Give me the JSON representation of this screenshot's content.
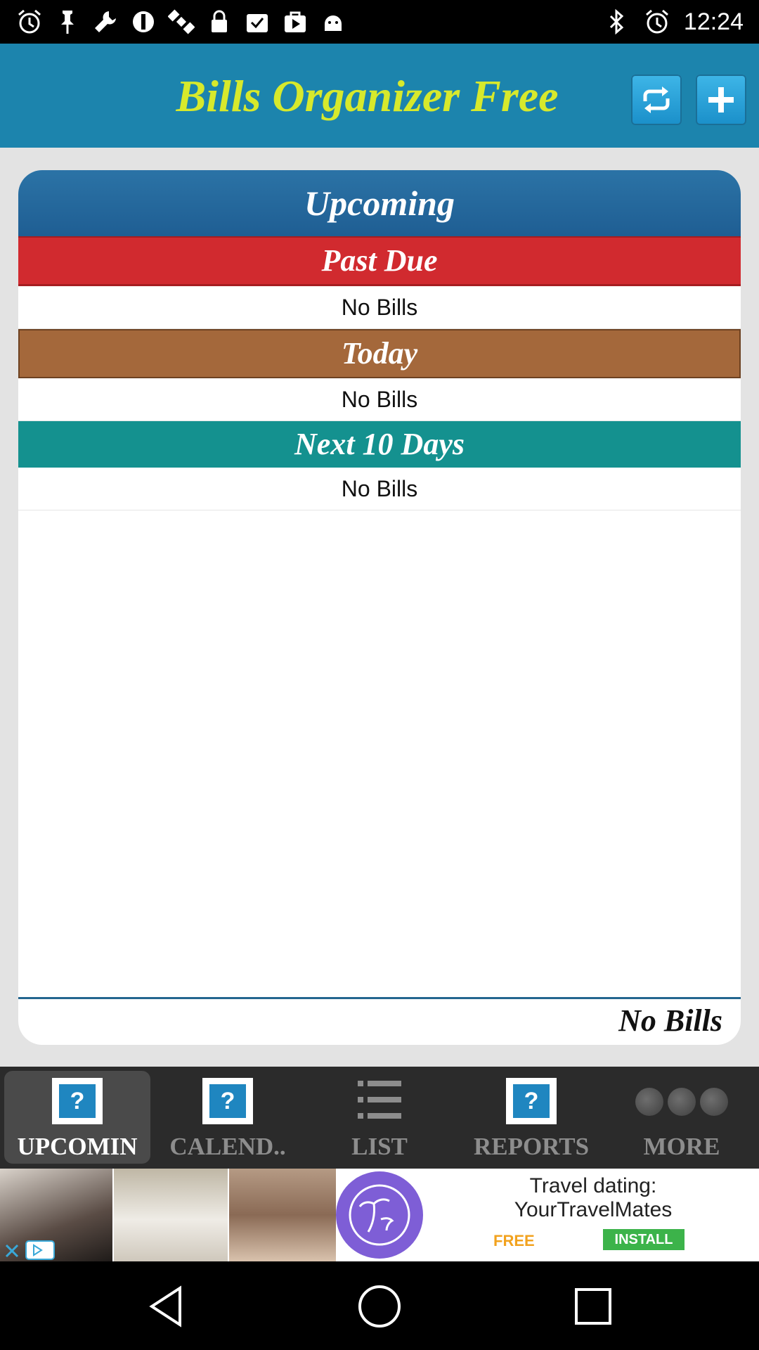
{
  "status_bar": {
    "time": "12:24",
    "icons": [
      "alarm-icon",
      "pin-icon",
      "wrench-icon",
      "sync-icon",
      "satellite-icon",
      "lock-icon",
      "clipboard-check-icon",
      "play-store-icon",
      "android-icon",
      "bluetooth-icon",
      "alarm-icon"
    ]
  },
  "app_bar": {
    "title": "Bills Organizer Free",
    "title_color": "#d7e92c",
    "background": "#1c84ad"
  },
  "upcoming": {
    "header": "Upcoming",
    "sections": [
      {
        "title": "Past Due",
        "color": "#d12a2f",
        "empty_text": "No Bills"
      },
      {
        "title": "Today",
        "color": "#a4683b",
        "empty_text": "No Bills"
      },
      {
        "title": "Next 10 Days",
        "color": "#14918f",
        "empty_text": "No Bills"
      }
    ],
    "footer_total": "No Bills"
  },
  "tabs": [
    {
      "label": "UPCOMIN",
      "icon": "help-icon",
      "active": true
    },
    {
      "label": "CALEND..",
      "icon": "help-icon",
      "active": false
    },
    {
      "label": "LIST",
      "icon": "list-icon",
      "active": false
    },
    {
      "label": "REPORTS",
      "icon": "help-icon",
      "active": false
    },
    {
      "label": "MORE",
      "icon": "more-dots-icon",
      "active": false
    }
  ],
  "ad": {
    "line1": "Travel dating:",
    "line2": "YourTravelMates",
    "free_label": "FREE",
    "install_label": "INSTALL"
  },
  "nav_bar": {
    "buttons": [
      "back-icon",
      "home-icon",
      "recents-icon"
    ]
  }
}
